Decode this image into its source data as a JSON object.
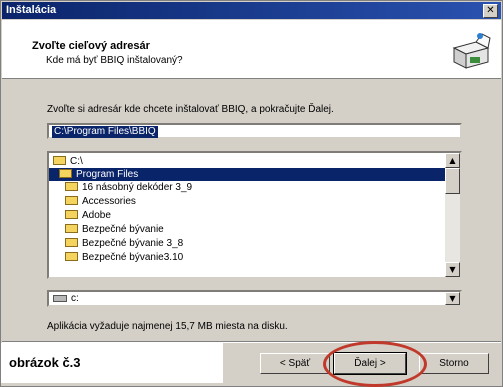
{
  "window": {
    "title": "Inštalácia",
    "close_glyph": "✕"
  },
  "header": {
    "title": "Zvoľte cieľový adresár",
    "subtitle": "Kde má byť BBIQ inštalovaný?",
    "icon": "installer-box-icon"
  },
  "instruction": "Zvoľte si adresár kde chcete inštalovať BBIQ, a pokračujte Ďalej.",
  "path_value": "C:\\Program Files\\BBIQ",
  "folder_list": {
    "items": [
      {
        "label": "C:\\",
        "selected": false
      },
      {
        "label": "Program Files",
        "selected": true
      },
      {
        "label": "16 násobný dekóder 3_9",
        "selected": false
      },
      {
        "label": "Accessories",
        "selected": false
      },
      {
        "label": "Adobe",
        "selected": false
      },
      {
        "label": "Bezpečné bývanie",
        "selected": false
      },
      {
        "label": "Bezpečné bývanie 3_8",
        "selected": false
      },
      {
        "label": "Bezpečné bývanie3.10",
        "selected": false
      }
    ],
    "scroll_up": "▲",
    "scroll_down": "▼"
  },
  "drive": {
    "label": "c:",
    "dropdown_glyph": "▼"
  },
  "space_required": "Aplikácia vyžaduje najmenej 15,7 MB miesta na disku.",
  "caption": "obrázok č.3",
  "buttons": {
    "back": "< Späť",
    "next": "Ďalej >",
    "cancel": "Storno"
  },
  "colors": {
    "title_bar": "#0a246a",
    "selection": "#0a246a",
    "annotation_circle": "#c0392b"
  }
}
